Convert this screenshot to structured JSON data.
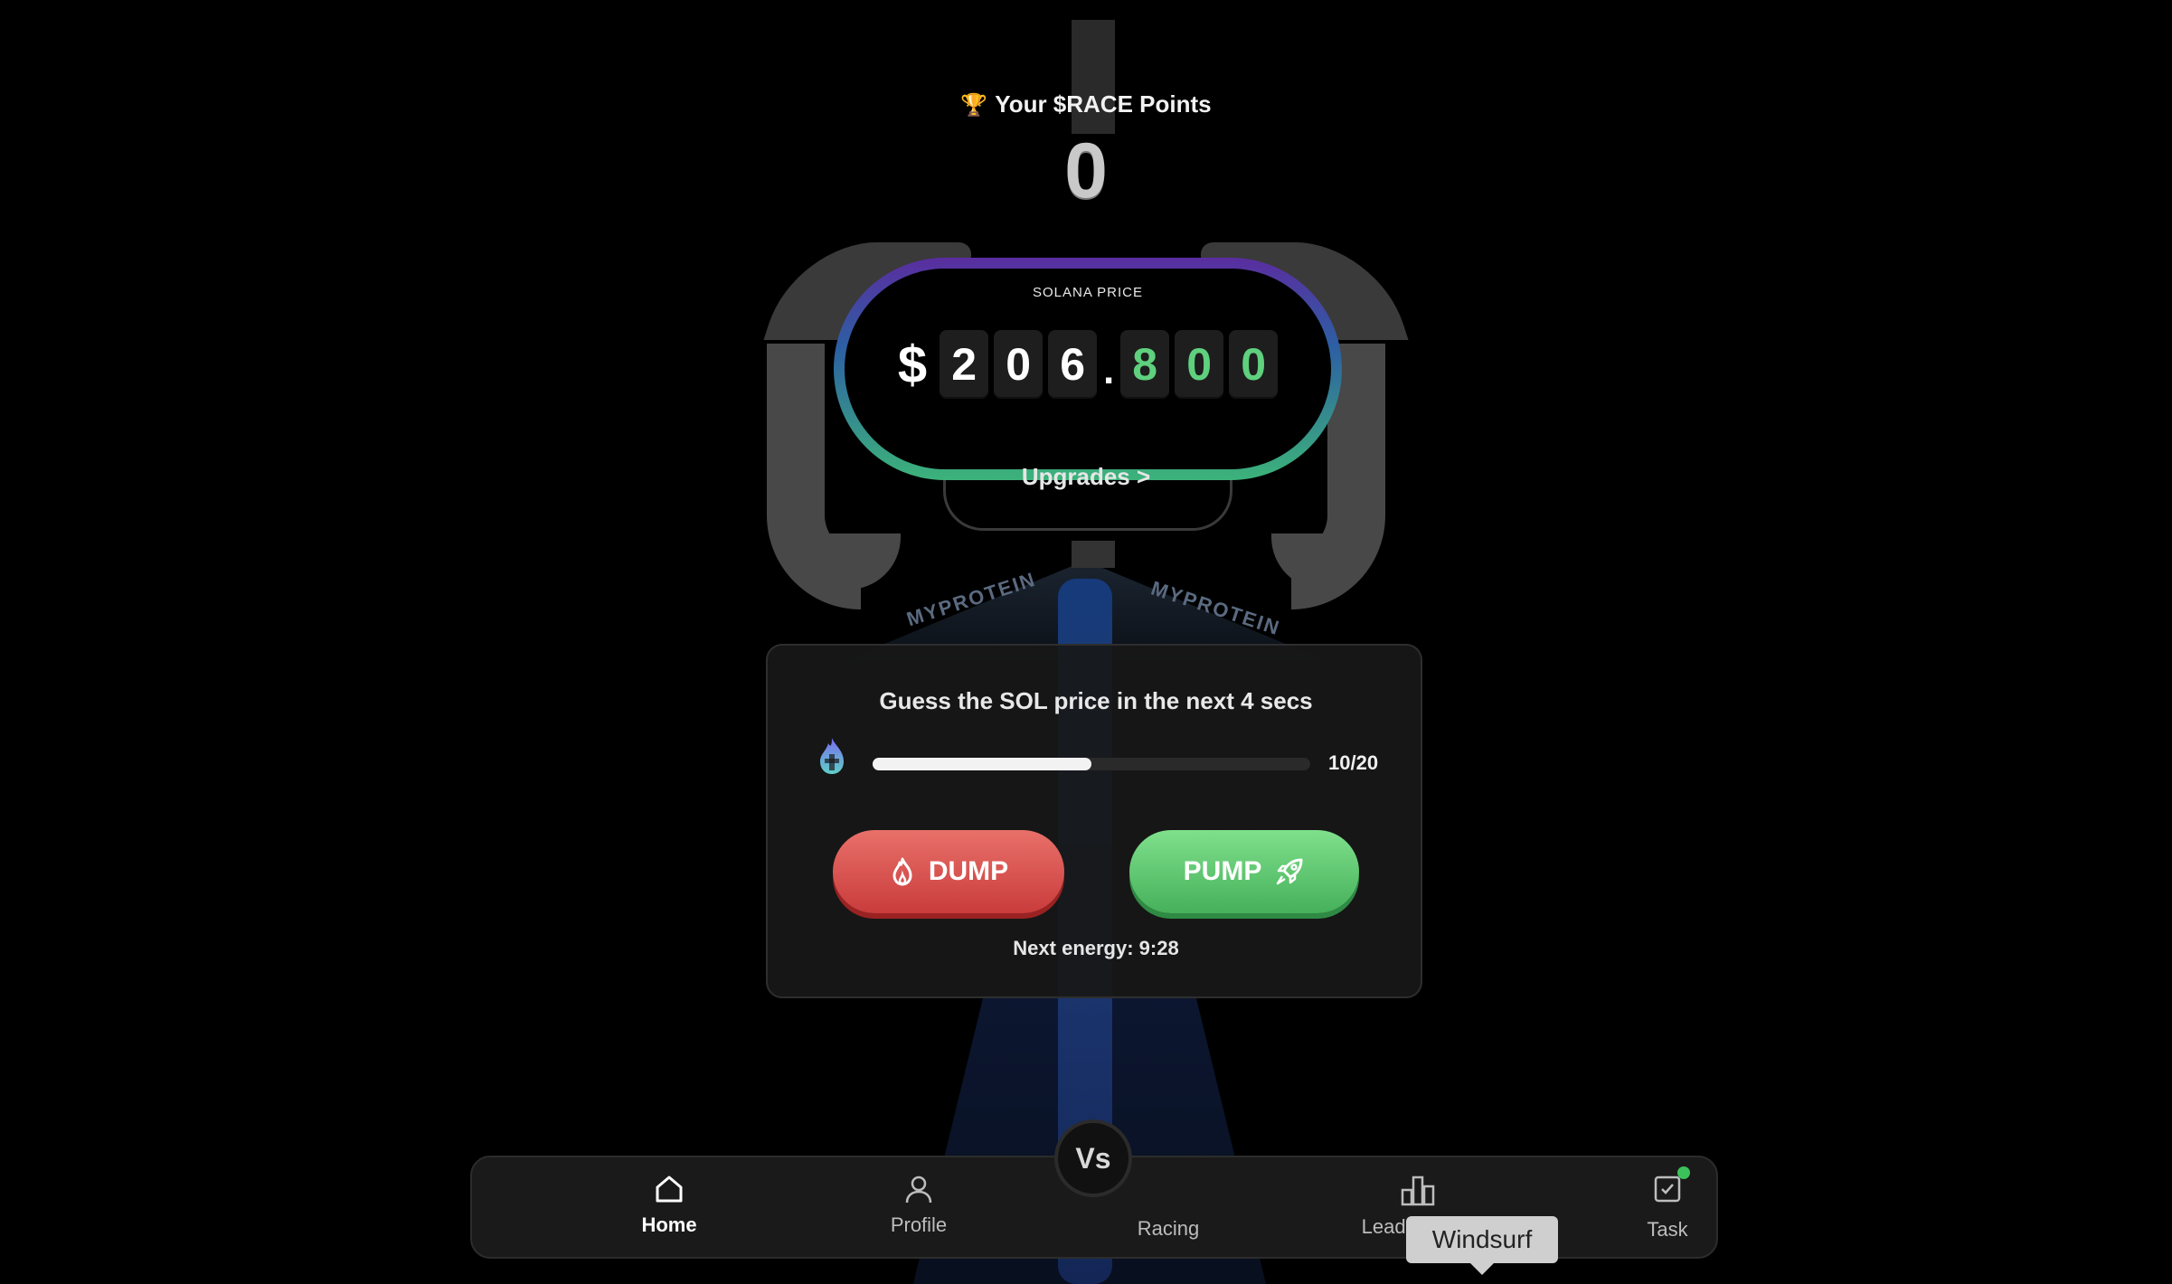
{
  "header": {
    "points_title": "Your $RACE Points",
    "trophy_icon": "🏆",
    "points_value": "0"
  },
  "price": {
    "label": "SOLANA PRICE",
    "currency_symbol": "$",
    "digits_whole": [
      "2",
      "0",
      "6"
    ],
    "decimal_point": ".",
    "digits_fraction": [
      "8",
      "0",
      "0"
    ]
  },
  "upgrades": {
    "label": "Upgrades >"
  },
  "car": {
    "text_left": "MYPROTEIN",
    "text_right": "MYPROTEIN"
  },
  "game": {
    "title": "Guess the SOL price in the next 4 secs",
    "energy_icon": "flame-icon",
    "energy_current": 10,
    "energy_max": 20,
    "energy_count": "10/20",
    "dump_label": "DUMP",
    "pump_label": "PUMP",
    "next_energy": "Next energy: 9:28"
  },
  "nav": {
    "items": [
      {
        "label": "Home",
        "icon": "home-icon",
        "active": true
      },
      {
        "label": "Profile",
        "icon": "user-icon",
        "active": false
      },
      {
        "label": "Racing",
        "icon": "vs-icon",
        "active": false
      },
      {
        "label": "Leaderboard",
        "icon": "bar-chart-icon",
        "active": false
      },
      {
        "label": "Task",
        "icon": "checkbox-icon",
        "active": false
      }
    ],
    "vs_label": "Vs"
  },
  "tooltip": {
    "label": "Windsurf"
  },
  "colors": {
    "background": "#000000",
    "green": "#5fd07e",
    "red": "#d9504c",
    "ring_top": "#5a2da0",
    "ring_bottom": "#3cb37a"
  }
}
